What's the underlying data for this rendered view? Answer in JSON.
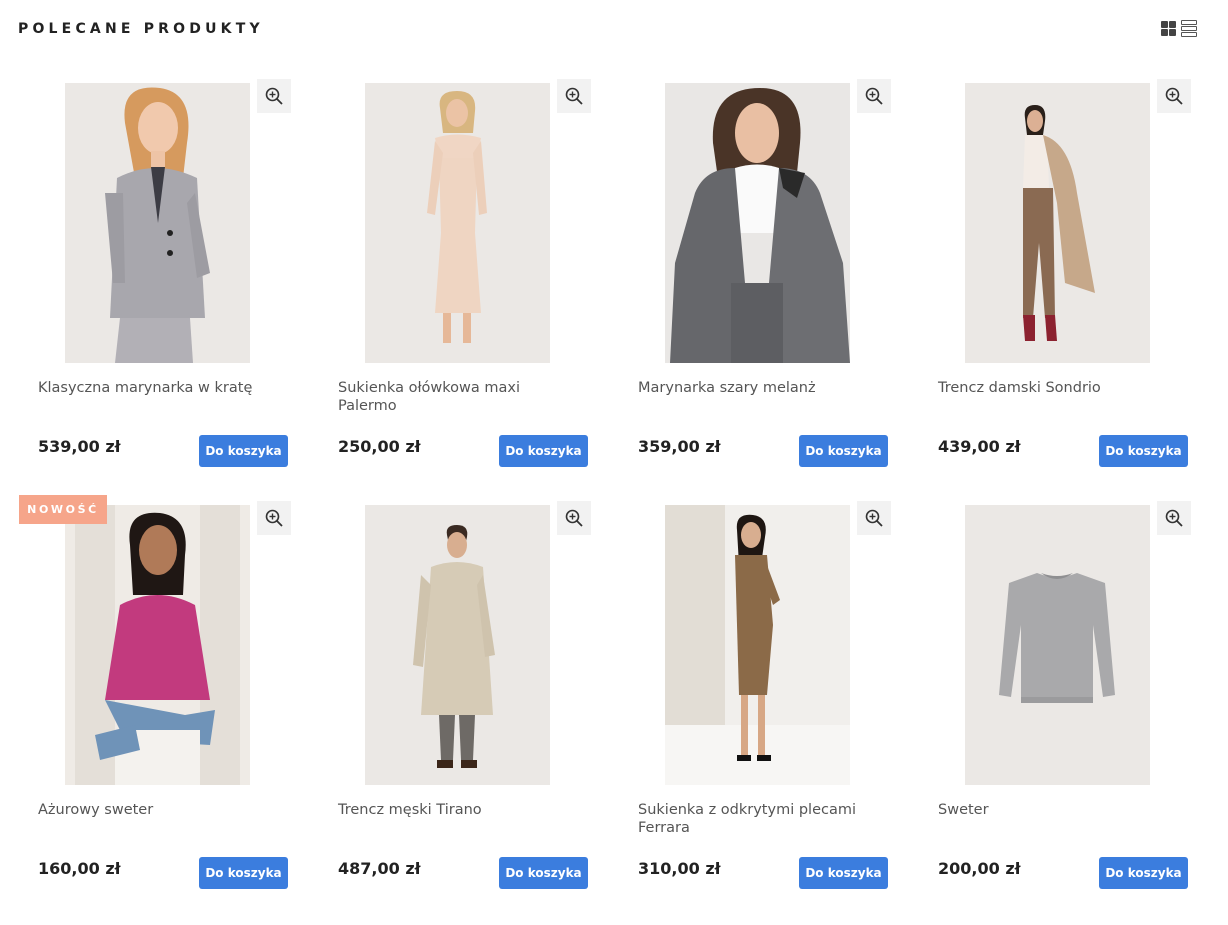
{
  "section": {
    "title": "POLECANE PRODUKTY"
  },
  "view_toggle": {
    "active": "grid",
    "icons": [
      "grid-icon",
      "list-icon"
    ]
  },
  "products": [
    {
      "name": "Klasyczna marynarka w kratę",
      "price": "539,00 zł",
      "button": "Do koszyka",
      "badge": ""
    },
    {
      "name": "Sukienka ołówkowa maxi Palermo",
      "price": "250,00 zł",
      "button": "Do koszyka",
      "badge": ""
    },
    {
      "name": "Marynarka szary melanż",
      "price": "359,00 zł",
      "button": "Do koszyka",
      "badge": ""
    },
    {
      "name": "Trencz damski Sondrio",
      "price": "439,00 zł",
      "button": "Do koszyka",
      "badge": ""
    },
    {
      "name": "Ażurowy sweter",
      "price": "160,00 zł",
      "button": "Do koszyka",
      "badge": "NOWOŚĆ"
    },
    {
      "name": "Trencz męski Tirano",
      "price": "487,00 zł",
      "button": "Do koszyka",
      "badge": ""
    },
    {
      "name": "Sukienka z odkrytymi plecami Ferrara",
      "price": "310,00 zł",
      "button": "Do koszyka",
      "badge": ""
    },
    {
      "name": "Sweter",
      "price": "200,00 zł",
      "button": "Do koszyka",
      "badge": ""
    }
  ],
  "colors": {
    "button": "#3b7dde",
    "badge": "#f6a58a",
    "image_bg": "#ebe8e5",
    "zoom_bg": "#f2f2f2"
  }
}
